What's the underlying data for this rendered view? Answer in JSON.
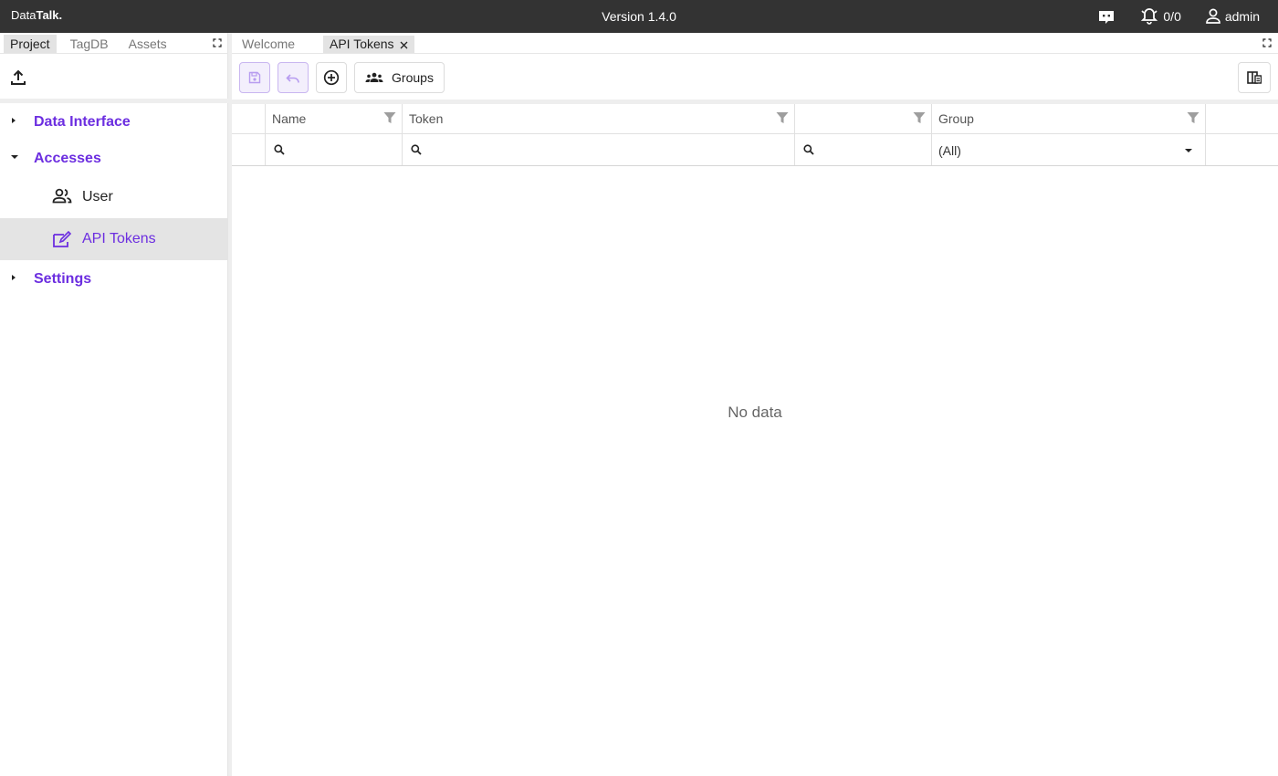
{
  "app": {
    "logo_prefix": "Data",
    "logo_bold": "Talk.",
    "version": "Version 1.4.0",
    "alarm_count": "0/0",
    "user": "admin"
  },
  "left_panel": {
    "tabs": [
      "Project",
      "TagDB",
      "Assets"
    ],
    "active_tab": "Project",
    "tree": {
      "data_interface": "Data Interface",
      "accesses": "Accesses",
      "user": "User",
      "api_tokens": "API Tokens",
      "settings": "Settings"
    }
  },
  "doc_tabs": {
    "welcome": "Welcome",
    "api_tokens": "API Tokens"
  },
  "toolbar": {
    "groups_label": "Groups"
  },
  "grid": {
    "columns": [
      "Name",
      "Token",
      "",
      "Group"
    ],
    "group_filter_value": "(All)",
    "empty_text": "No data"
  },
  "colors": {
    "accent": "#6c2ee0",
    "topbar": "#333333",
    "selected_row": "#e4e4e4"
  }
}
